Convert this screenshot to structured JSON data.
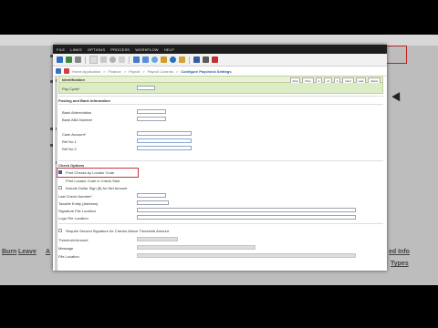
{
  "menu": [
    "FILE",
    "LINKS",
    "OPTIONS",
    "PROCESS",
    "WORKFLOW",
    "HELP"
  ],
  "breadcrumb": {
    "items": [
      "Home Application",
      "Finance",
      "Payroll",
      "Payroll Controls"
    ],
    "current": "Configure Paycheck Settings"
  },
  "identification": {
    "title": "Identification",
    "buttons": [
      "First",
      "Prev",
      "1",
      "of",
      "1",
      "Next",
      "Last",
      "Alerts"
    ],
    "pay_cycle_label": "Pay Cycle",
    "pay_cycle_value": ""
  },
  "posting": {
    "title": "Posting and Bank Information",
    "bank_abbreviation_label": "Bank Abbreviation",
    "bank_aba_label": "Bank ABA Number",
    "cash_account_label": "Cash Account",
    "ref1_label": "Ref No 1",
    "ref2_label": "Ref No 2"
  },
  "check_options": {
    "title": "Check Options",
    "print_by_locator_label": "Print Checks by Locator Code",
    "print_by_locator_checked": true,
    "print_locator_on_stub_label": "Print Locator Code in Check Stub",
    "dollar_sign_label": "Include Dollar Sign ($) for Net Amount",
    "last_check_label": "Last Check Number",
    "taxable_entity_label": "Taxable Entity (Address)",
    "signature_file_label": "Signature File Location",
    "logo_file_label": "Logo File Location",
    "second_signature_label": "Require Second Signature for Checks Above Threshold Amount",
    "threshold_label": "Threshold Amount",
    "message_label": "Message",
    "file_location_label": "File Location"
  },
  "background": {
    "links": [
      "Burn",
      "Leave",
      "A",
      "ed Info",
      "Types"
    ]
  },
  "colors": {
    "menubar": "#1d1d1d",
    "section_green": "#dcecc5",
    "highlight_red": "#c0393b",
    "checkbox_blue": "#3b6fc4"
  }
}
